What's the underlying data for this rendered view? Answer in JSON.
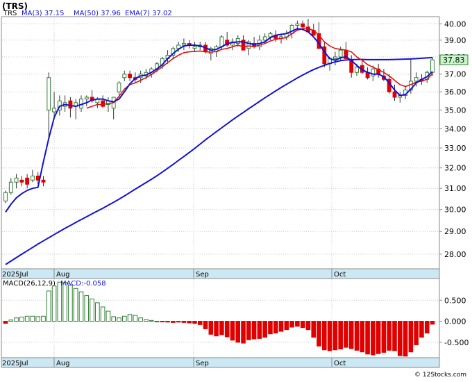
{
  "title": "(TRS)",
  "credit": "© 12Stocks.com",
  "colors": {
    "up": "#2e7d32",
    "down": "#e00000",
    "ma_blue": "#1010dd",
    "ema_red": "#e01010",
    "axis_bar": "#cce8f4",
    "grid": "#c8c8c8",
    "price_tag_bg": "#c9f7c9"
  },
  "chart_data": [
    {
      "type": "candlestick",
      "ticker": "TRS",
      "legend": {
        "ticker": "TRS",
        "ma3": "MA(3)  37.15",
        "ma50": "MA(50)  37.96",
        "ema7": "EMA(7)  37.02"
      },
      "x_labels": [
        "2025Jul",
        "Aug",
        "Sep",
        "Oct"
      ],
      "y_ticks": [
        "28.00",
        "29.00",
        "30.00",
        "31.00",
        "32.00",
        "33.00",
        "34.00",
        "35.00",
        "36.00",
        "37.00",
        "38.00",
        "39.00",
        "40.00"
      ],
      "ylim": [
        27.4,
        40.4
      ],
      "y_scale": "log",
      "grid": true,
      "last_price": "37.83",
      "ohlc": [
        [
          30.4,
          30.9,
          30.3,
          30.8
        ],
        [
          30.8,
          31.5,
          30.7,
          31.3
        ],
        [
          31.3,
          31.7,
          31.0,
          31.5
        ],
        [
          31.4,
          31.6,
          31.1,
          31.3
        ],
        [
          31.5,
          31.7,
          31.0,
          31.2
        ],
        [
          31.4,
          31.9,
          31.3,
          31.6
        ],
        [
          31.6,
          31.8,
          31.2,
          31.4
        ],
        [
          31.4,
          31.6,
          31.1,
          31.3
        ],
        [
          35.0,
          37.1,
          33.5,
          36.8
        ],
        [
          34.9,
          36.0,
          34.5,
          35.1
        ],
        [
          35.0,
          35.8,
          34.7,
          35.5
        ],
        [
          35.2,
          35.8,
          34.9,
          35.4
        ],
        [
          35.5,
          35.7,
          34.6,
          35.1
        ],
        [
          35.2,
          35.6,
          34.5,
          35.4
        ],
        [
          35.1,
          35.8,
          34.9,
          35.6
        ],
        [
          35.6,
          35.8,
          35.2,
          35.7
        ],
        [
          35.7,
          36.1,
          35.4,
          35.5
        ],
        [
          35.4,
          35.7,
          35.1,
          35.6
        ],
        [
          35.5,
          35.8,
          35.1,
          35.2
        ],
        [
          35.3,
          35.7,
          34.9,
          35.5
        ],
        [
          35.1,
          35.7,
          34.5,
          35.7
        ],
        [
          36.0,
          36.6,
          35.8,
          36.5
        ],
        [
          36.8,
          37.2,
          36.6,
          37.0
        ],
        [
          37.0,
          37.2,
          36.6,
          36.8
        ],
        [
          36.8,
          37.1,
          36.5,
          36.7
        ],
        [
          36.8,
          37.2,
          36.5,
          37.0
        ],
        [
          36.9,
          37.3,
          36.7,
          37.1
        ],
        [
          37.0,
          37.4,
          36.8,
          37.3
        ],
        [
          37.3,
          37.7,
          37.1,
          37.6
        ],
        [
          37.5,
          38.0,
          37.3,
          37.9
        ],
        [
          37.9,
          38.4,
          37.6,
          38.1
        ],
        [
          38.1,
          38.6,
          37.9,
          38.5
        ],
        [
          38.5,
          38.9,
          38.3,
          38.7
        ],
        [
          38.7,
          39.1,
          38.4,
          38.8
        ],
        [
          38.8,
          39.0,
          38.5,
          38.7
        ],
        [
          38.5,
          38.9,
          38.3,
          38.6
        ],
        [
          38.6,
          38.9,
          38.4,
          38.7
        ],
        [
          38.7,
          38.9,
          38.2,
          38.3
        ],
        [
          38.2,
          38.6,
          37.8,
          38.5
        ],
        [
          38.3,
          38.7,
          38.0,
          38.6
        ],
        [
          38.6,
          39.3,
          38.4,
          39.2
        ],
        [
          39.0,
          39.5,
          38.6,
          38.7
        ],
        [
          38.7,
          39.1,
          38.4,
          38.9
        ],
        [
          38.8,
          39.3,
          38.6,
          39.1
        ],
        [
          39.0,
          39.3,
          38.5,
          38.4
        ],
        [
          38.5,
          39.0,
          38.1,
          38.9
        ],
        [
          38.8,
          39.2,
          38.5,
          38.6
        ],
        [
          38.6,
          39.3,
          38.4,
          39.0
        ],
        [
          39.0,
          39.4,
          38.8,
          39.2
        ],
        [
          39.2,
          39.5,
          39.0,
          39.4
        ],
        [
          39.3,
          39.6,
          38.9,
          39.1
        ],
        [
          39.1,
          39.4,
          38.8,
          39.2
        ],
        [
          39.2,
          39.6,
          39.0,
          39.4
        ],
        [
          39.4,
          40.0,
          39.1,
          39.9
        ],
        [
          39.9,
          40.2,
          39.6,
          40.0
        ],
        [
          40.0,
          40.2,
          39.6,
          39.8
        ],
        [
          39.8,
          40.3,
          39.5,
          39.5
        ],
        [
          39.6,
          40.0,
          39.3,
          39.3
        ],
        [
          39.4,
          40.1,
          38.6,
          38.5
        ],
        [
          38.6,
          38.9,
          37.4,
          37.6
        ],
        [
          37.6,
          38.0,
          37.2,
          37.9
        ],
        [
          37.9,
          38.3,
          37.5,
          38.0
        ],
        [
          38.0,
          38.6,
          37.8,
          38.4
        ],
        [
          38.4,
          38.9,
          38.0,
          37.9
        ],
        [
          37.8,
          38.1,
          36.8,
          37.1
        ],
        [
          37.1,
          37.6,
          36.9,
          37.4
        ],
        [
          37.5,
          37.9,
          37.0,
          37.1
        ],
        [
          37.1,
          37.4,
          36.7,
          36.8
        ],
        [
          36.9,
          37.5,
          36.6,
          37.3
        ],
        [
          37.3,
          37.6,
          36.8,
          37.0
        ],
        [
          36.9,
          37.3,
          36.6,
          36.7
        ],
        [
          36.7,
          37.0,
          35.9,
          36.0
        ],
        [
          36.0,
          36.4,
          35.5,
          35.7
        ],
        [
          35.7,
          36.0,
          35.4,
          35.8
        ],
        [
          35.8,
          36.3,
          35.6,
          36.1
        ],
        [
          36.1,
          37.9,
          35.9,
          36.6
        ],
        [
          36.6,
          37.1,
          36.3,
          36.8
        ],
        [
          36.7,
          37.0,
          36.4,
          36.6
        ],
        [
          36.7,
          37.2,
          36.5,
          37.1
        ],
        [
          37.1,
          38.0,
          36.9,
          37.83
        ]
      ],
      "ma50": [
        27.55,
        27.7,
        27.85,
        28.0,
        28.14,
        28.29,
        28.44,
        28.58,
        28.72,
        28.86,
        29.0,
        29.14,
        29.27,
        29.41,
        29.54,
        29.67,
        29.8,
        29.93,
        30.06,
        30.2,
        30.34,
        30.49,
        30.64,
        30.8,
        30.96,
        31.12,
        31.28,
        31.44,
        31.61,
        31.79,
        31.98,
        32.17,
        32.37,
        32.57,
        32.77,
        32.98,
        33.2,
        33.42,
        33.63,
        33.84,
        34.05,
        34.26,
        34.47,
        34.67,
        34.87,
        35.07,
        35.27,
        35.47,
        35.67,
        35.86,
        36.05,
        36.24,
        36.42,
        36.6,
        36.78,
        36.95,
        37.11,
        37.26,
        37.39,
        37.51,
        37.62,
        37.71,
        37.78,
        37.82,
        37.84,
        37.85,
        37.85,
        37.84,
        37.84,
        37.84,
        37.84,
        37.84,
        37.85,
        37.86,
        37.87,
        37.88,
        37.9,
        37.92,
        37.94,
        37.96
      ],
      "ema_seg_start": 15,
      "ema7": [
        35.1,
        35.2,
        35.3,
        35.3,
        35.35,
        35.4,
        35.75,
        36.15,
        36.4,
        36.5,
        36.65,
        36.8,
        36.98,
        37.2,
        37.42,
        37.66,
        37.9,
        38.1,
        38.25,
        38.3,
        38.32,
        38.35,
        38.3,
        38.28,
        38.32,
        38.45,
        38.5,
        38.6,
        38.7,
        38.6,
        38.65,
        38.62,
        38.7,
        38.8,
        38.95,
        39.05,
        39.1,
        39.15,
        39.4,
        39.6,
        39.7,
        39.7,
        39.6,
        39.3,
        38.9,
        38.65,
        38.5,
        38.45,
        38.4,
        38.3,
        38.0,
        37.8,
        37.55,
        37.4,
        37.25,
        37.1,
        36.9,
        36.65,
        36.4,
        36.3,
        36.4,
        36.55,
        36.6,
        36.7,
        37.02
      ],
      "ma3_seg_start": 0,
      "ma3": [
        29.88,
        30.25,
        30.55,
        30.75,
        30.9,
        31.0,
        31.05,
        32.3,
        33.5,
        34.6,
        35.2,
        35.3,
        35.25,
        35.2,
        35.3,
        35.4,
        35.55,
        35.6,
        35.6,
        35.5,
        35.45,
        35.6,
        36.0,
        36.45,
        36.75,
        36.9,
        36.95,
        37.1,
        37.3,
        37.55,
        37.9,
        38.2,
        38.45,
        38.65,
        38.7,
        38.7,
        38.65,
        38.55,
        38.4,
        38.45,
        38.6,
        38.8,
        38.85,
        38.9,
        38.9,
        38.8,
        38.75,
        38.8,
        38.9,
        39.15,
        39.3,
        39.35,
        39.4,
        39.55,
        39.7,
        39.65,
        39.5,
        39.2,
        38.8,
        38.3,
        37.9,
        37.8,
        37.95,
        38.0,
        37.8,
        37.5,
        37.25,
        37.1,
        37.0,
        37.0,
        36.85,
        36.5,
        36.1,
        35.8,
        35.85,
        36.15,
        36.5,
        36.7,
        36.85,
        37.15
      ]
    },
    {
      "type": "bar",
      "title": "MACD(26,12,9)",
      "legend": "MACD:-0.058",
      "y_ticks": [
        "0.500",
        "0.000",
        "-0.500"
      ],
      "ylim": [
        -0.85,
        1.0
      ],
      "grid": true,
      "x_labels": [
        "2025Jul",
        "Aug",
        "Sep",
        "Oct"
      ],
      "values": [
        -0.05,
        0.03,
        0.08,
        0.1,
        0.12,
        0.12,
        0.11,
        0.12,
        0.72,
        0.84,
        0.93,
        0.92,
        0.86,
        0.78,
        0.7,
        0.61,
        0.53,
        0.44,
        0.34,
        0.24,
        0.11,
        0.08,
        0.12,
        0.16,
        0.14,
        0.08,
        0.04,
        0.02,
        0.0,
        -0.01,
        -0.02,
        -0.03,
        -0.02,
        -0.03,
        -0.04,
        -0.05,
        -0.08,
        -0.18,
        -0.31,
        -0.35,
        -0.32,
        -0.37,
        -0.45,
        -0.5,
        -0.52,
        -0.44,
        -0.42,
        -0.41,
        -0.38,
        -0.3,
        -0.28,
        -0.24,
        -0.2,
        -0.14,
        -0.12,
        -0.15,
        -0.2,
        -0.38,
        -0.59,
        -0.68,
        -0.7,
        -0.68,
        -0.66,
        -0.62,
        -0.65,
        -0.69,
        -0.73,
        -0.78,
        -0.8,
        -0.77,
        -0.74,
        -0.69,
        -0.7,
        -0.82,
        -0.83,
        -0.73,
        -0.56,
        -0.38,
        -0.28,
        -0.07
      ]
    }
  ]
}
